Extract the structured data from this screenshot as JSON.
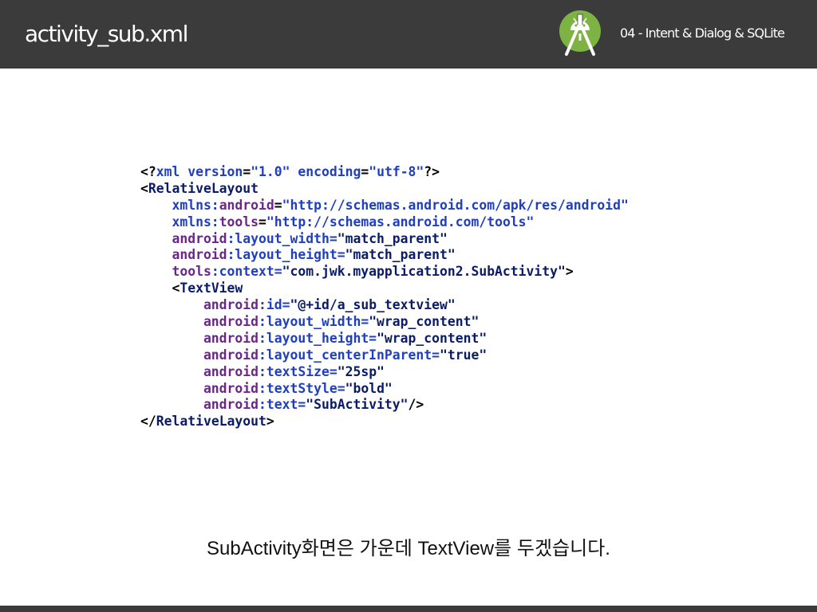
{
  "header": {
    "title": "activity_sub.xml",
    "subtitle": "04 - Intent & Dialog & SQLite",
    "logo_icon": "android-studio-logo-icon",
    "background_color": "#3b3b3b"
  },
  "code": {
    "lines": [
      [
        {
          "t": "<?",
          "c": "n"
        },
        {
          "t": "xml version",
          "c": "g"
        },
        {
          "t": "=",
          "c": "n"
        },
        {
          "t": "\"1.0\"",
          "c": "g"
        },
        {
          "t": " encoding",
          "c": "g"
        },
        {
          "t": "=",
          "c": "n"
        },
        {
          "t": "\"utf-8\"",
          "c": "g"
        },
        {
          "t": "?>",
          "c": "n"
        }
      ],
      [
        {
          "t": "<",
          "c": "n"
        },
        {
          "t": "RelativeLayout",
          "c": "b"
        }
      ],
      [
        {
          "t": "    xmlns:",
          "c": "g"
        },
        {
          "t": "android",
          "c": "a"
        },
        {
          "t": "=",
          "c": "n"
        },
        {
          "t": "\"http://schemas.android.com/apk/res/android\"",
          "c": "g"
        }
      ],
      [
        {
          "t": "    xmlns:",
          "c": "g"
        },
        {
          "t": "tools",
          "c": "a"
        },
        {
          "t": "=",
          "c": "n"
        },
        {
          "t": "\"http://schemas.android.com/tools\"",
          "c": "g"
        }
      ],
      [
        {
          "t": "    android",
          "c": "a"
        },
        {
          "t": ":layout_width=",
          "c": "g"
        },
        {
          "t": "\"match_parent\"",
          "c": "b"
        }
      ],
      [
        {
          "t": "    android",
          "c": "a"
        },
        {
          "t": ":layout_height=",
          "c": "g"
        },
        {
          "t": "\"match_parent\"",
          "c": "b"
        }
      ],
      [
        {
          "t": "    tools",
          "c": "a"
        },
        {
          "t": ":context=",
          "c": "g"
        },
        {
          "t": "\"com.jwk.myapplication2.SubActivity\"",
          "c": "b"
        },
        {
          "t": ">",
          "c": "n"
        }
      ],
      [
        {
          "t": "    <",
          "c": "n"
        },
        {
          "t": "TextView",
          "c": "b"
        }
      ],
      [
        {
          "t": "        android",
          "c": "a"
        },
        {
          "t": ":id=",
          "c": "g"
        },
        {
          "t": "\"@+id/a_sub_textview\"",
          "c": "b"
        }
      ],
      [
        {
          "t": "        android",
          "c": "a"
        },
        {
          "t": ":layout_width=",
          "c": "g"
        },
        {
          "t": "\"wrap_content\"",
          "c": "b"
        }
      ],
      [
        {
          "t": "        android",
          "c": "a"
        },
        {
          "t": ":layout_height=",
          "c": "g"
        },
        {
          "t": "\"wrap_content\"",
          "c": "b"
        }
      ],
      [
        {
          "t": "        android",
          "c": "a"
        },
        {
          "t": ":layout_centerInParent=",
          "c": "g"
        },
        {
          "t": "\"true\"",
          "c": "b"
        }
      ],
      [
        {
          "t": "        android",
          "c": "a"
        },
        {
          "t": ":textSize=",
          "c": "g"
        },
        {
          "t": "\"25sp\"",
          "c": "b"
        }
      ],
      [
        {
          "t": "        android",
          "c": "a"
        },
        {
          "t": ":textStyle=",
          "c": "g"
        },
        {
          "t": "\"bold\"",
          "c": "b"
        }
      ],
      [
        {
          "t": "        android",
          "c": "a"
        },
        {
          "t": ":text=",
          "c": "g"
        },
        {
          "t": "\"SubActivity\"",
          "c": "b"
        },
        {
          "t": "/>",
          "c": "n"
        }
      ],
      [
        {
          "t": "</",
          "c": "n"
        },
        {
          "t": "RelativeLayout",
          "c": "b"
        },
        {
          "t": ">",
          "c": "n"
        }
      ]
    ],
    "colors": {
      "tag": "#0b1c66",
      "attr": "#6a2787",
      "keyword": "#1f3fbf",
      "plain": "#000000"
    }
  },
  "caption": "SubActivity화면은 가운데 TextView를 두겠습니다."
}
